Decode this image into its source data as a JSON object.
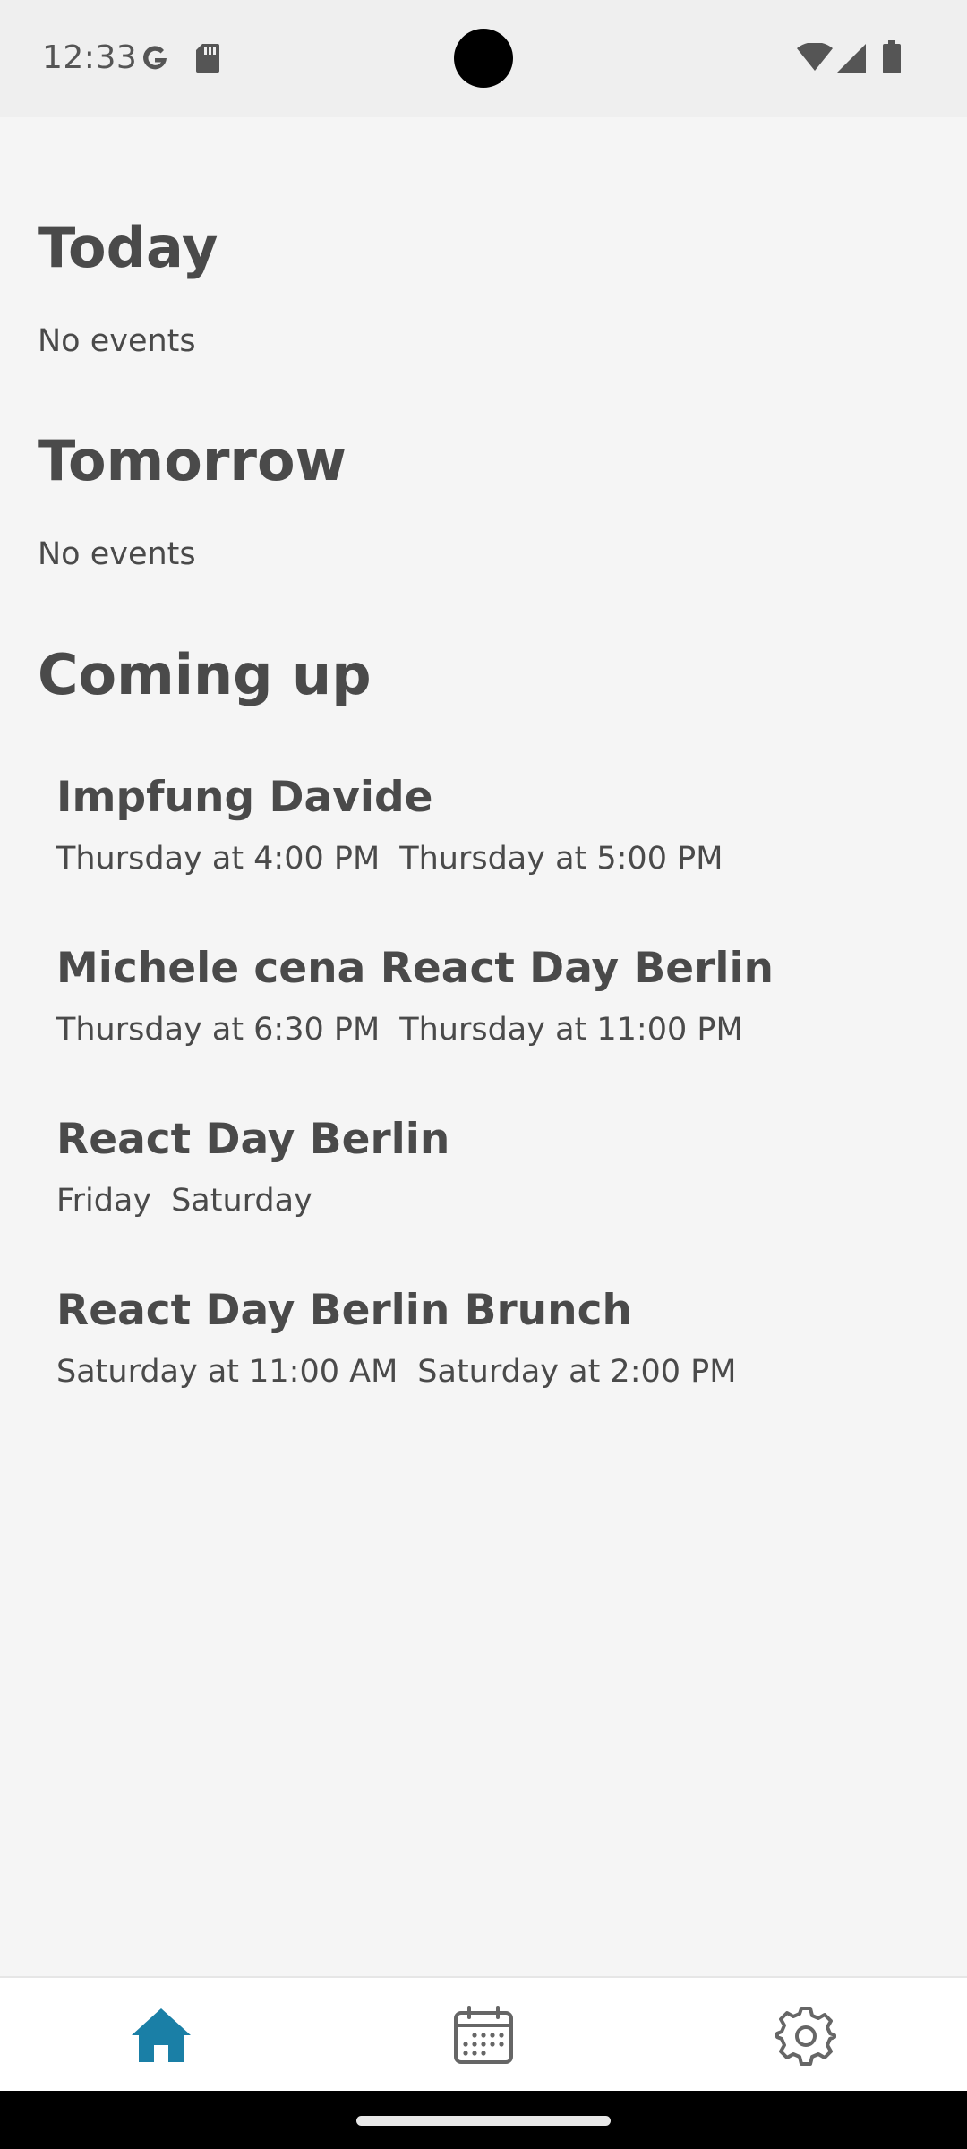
{
  "status_bar": {
    "time": "12:33",
    "icons": [
      "google-icon",
      "sd-card-icon",
      "wifi-icon",
      "cell-signal-icon",
      "battery-icon"
    ]
  },
  "sections": {
    "today": {
      "title": "Today",
      "empty_text": "No events"
    },
    "tomorrow": {
      "title": "Tomorrow",
      "empty_text": "No events"
    },
    "coming_up": {
      "title": "Coming up",
      "events": [
        {
          "title": "Impfung Davide",
          "start": "Thursday at 4:00 PM",
          "end": "Thursday at 5:00 PM"
        },
        {
          "title": "Michele cena React Day Berlin",
          "start": "Thursday at 6:30 PM",
          "end": "Thursday at 11:00 PM"
        },
        {
          "title": "React Day Berlin",
          "start": "Friday",
          "end": "Saturday"
        },
        {
          "title": "React Day Berlin Brunch",
          "start": "Saturday at 11:00 AM",
          "end": "Saturday at 2:00 PM"
        }
      ]
    }
  },
  "tab_bar": {
    "active_color": "#1a7fa6",
    "inactive_color": "#666666",
    "tabs": [
      {
        "icon": "home-icon",
        "active": true
      },
      {
        "icon": "calendar-icon",
        "active": false
      },
      {
        "icon": "settings-gear-icon",
        "active": false
      }
    ]
  }
}
